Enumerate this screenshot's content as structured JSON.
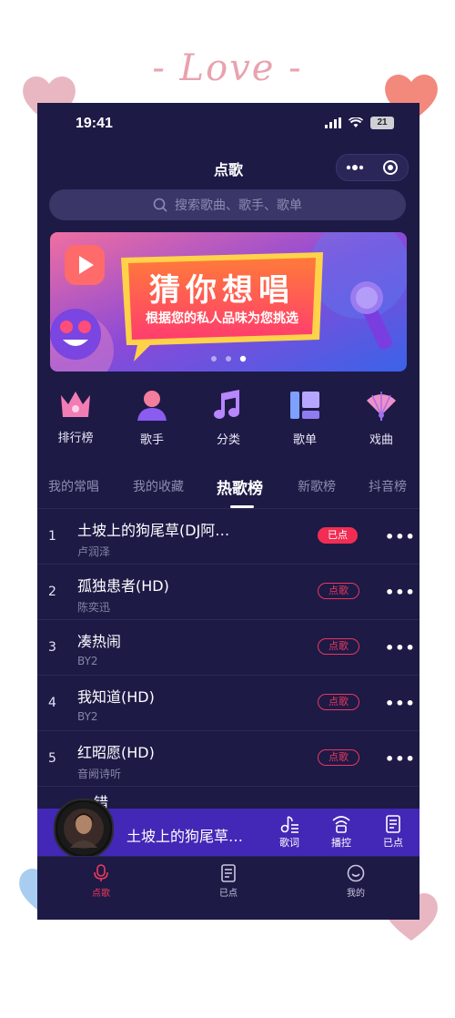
{
  "decoration": {
    "love_text": "- Love -"
  },
  "status_bar": {
    "time": "19:41",
    "battery": "21"
  },
  "navbar": {
    "title": "点歌"
  },
  "search": {
    "placeholder": "搜索歌曲、歌手、歌单"
  },
  "banner": {
    "title": "猜你想唱",
    "subtitle": "根据您的私人品味为您挑选",
    "dots": 3,
    "active_dot": 2
  },
  "categories": [
    {
      "label": "排行榜",
      "icon": "crown-icon"
    },
    {
      "label": "歌手",
      "icon": "singer-icon"
    },
    {
      "label": "分类",
      "icon": "music-note-icon"
    },
    {
      "label": "歌单",
      "icon": "playlist-icon"
    },
    {
      "label": "戏曲",
      "icon": "fan-icon"
    }
  ],
  "tabs": [
    {
      "label": "我的常唱"
    },
    {
      "label": "我的收藏"
    },
    {
      "label": "热歌榜",
      "active": true
    },
    {
      "label": "新歌榜"
    },
    {
      "label": "抖音榜"
    }
  ],
  "songs": [
    {
      "rank": "1",
      "title": "土坡上的狗尾草(DJ阿…",
      "artist": "卢润泽",
      "status": "已点"
    },
    {
      "rank": "2",
      "title": "孤独患者(HD)",
      "artist": "陈奕迅",
      "status": "点歌"
    },
    {
      "rank": "3",
      "title": "凑热闹",
      "artist": "BY2",
      "status": "点歌"
    },
    {
      "rank": "4",
      "title": "我知道(HD)",
      "artist": "BY2",
      "status": "点歌"
    },
    {
      "rank": "5",
      "title": "红昭愿(HD)",
      "artist": "音阙诗听",
      "status": "点歌"
    }
  ],
  "partial_row": {
    "title_fragment": "错"
  },
  "player": {
    "now_playing": "土坡上的狗尾草…",
    "controls": [
      {
        "label": "歌词",
        "icon": "lyrics-icon"
      },
      {
        "label": "播控",
        "icon": "play-control-icon"
      },
      {
        "label": "已点",
        "icon": "queue-icon"
      }
    ]
  },
  "tabbar": [
    {
      "label": "点歌",
      "icon": "microphone-icon",
      "active": true
    },
    {
      "label": "已点",
      "icon": "list-icon"
    },
    {
      "label": "我的",
      "icon": "smile-icon"
    }
  ],
  "colors": {
    "background": "#1d1a46",
    "accent": "#f22d53",
    "player": "#4327b6"
  }
}
